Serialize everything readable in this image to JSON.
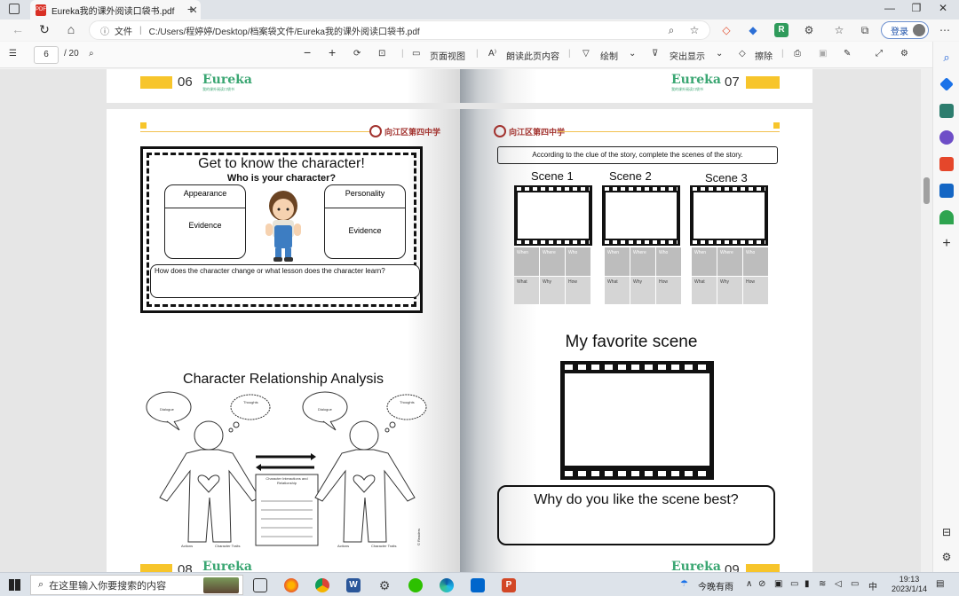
{
  "browser": {
    "tab_title": "Eureka我的课外阅读口袋书.pdf",
    "tab_close": "✕",
    "new_tab": "+",
    "address_label": "文件",
    "address_path": "C:/Users/程婷婷/Desktop/档案袋文件/Eureka我的课外阅读口袋书.pdf",
    "login_label": "登录"
  },
  "pdf_toolbar": {
    "current_page": "6",
    "total_pages": "/ 20",
    "zoom_out": "−",
    "zoom_in": "+",
    "page_view": "页面视图",
    "read_aloud": "朗读此页内容",
    "draw": "绘制",
    "highlight": "突出显示",
    "erase": "擦除"
  },
  "book": {
    "brand": "Eureka",
    "brand_sub": "我的课外阅读口袋书",
    "school_logo": "向江区第四中学",
    "top_left_page": "06",
    "top_right_page": "07",
    "bottom_left_page": "08",
    "bottom_right_page": "09",
    "left_page": {
      "title": "Get to know the character!",
      "subtitle": "Who is your character?",
      "appearance": "Appearance",
      "personality": "Personality",
      "evidence_left": "Evidence",
      "evidence_right": "Evidence",
      "question": "How does the character change or what lesson does the character learn?",
      "relationship_title": "Character Relationship Analysis",
      "dialogue_left": "Dialogue",
      "thoughts_left": "Thoughts",
      "dialogue_right": "Dialogue",
      "thoughts_right": "Thoughts",
      "center_box": "Character Interactions and Relationship",
      "actions_left": "Actions",
      "traits_left": "Character Traits",
      "actions_right": "Actions",
      "traits_right": "Character Traits",
      "credit": "© Readers"
    },
    "right_page": {
      "instruction": "According to the clue of the story, complete the scenes of the story.",
      "scenes": [
        "Scene 1",
        "Scene 2",
        "Scene 3"
      ],
      "grid_labels": [
        "When",
        "Where",
        "Who",
        "What",
        "Why",
        "How"
      ],
      "favorite_title": "My favorite scene",
      "why_question": "Why do you like the scene best?"
    }
  },
  "taskbar": {
    "search_placeholder": "在这里输入你要搜索的内容",
    "weather": "今晚有雨",
    "ime": "中",
    "time": "19:13",
    "date": "2023/1/14"
  }
}
